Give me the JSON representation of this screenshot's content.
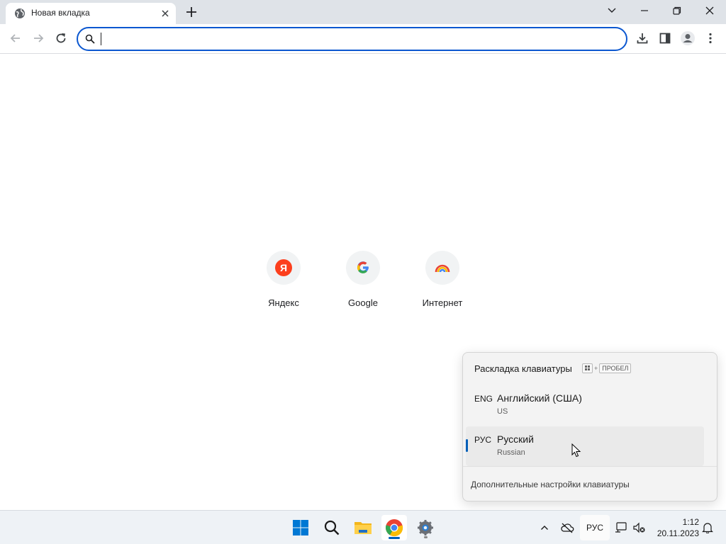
{
  "browser": {
    "tab": {
      "title": "Новая вкладка",
      "icon": "globe-icon"
    },
    "omnibox": {
      "value": "",
      "placeholder": ""
    },
    "shortcuts": [
      {
        "label": "Яндекс",
        "icon": "yandex-icon",
        "glyph": "Я",
        "color": "#fc3f1d"
      },
      {
        "label": "Google",
        "icon": "google-icon",
        "glyph": "G",
        "color": "#4285f4"
      },
      {
        "label": "Интернет",
        "icon": "internet-rainbow-icon"
      }
    ]
  },
  "flyout": {
    "title": "Раскладка клавиатуры",
    "shortcut_key": "ПРОБЕЛ",
    "shortcut_plus": "+",
    "languages": [
      {
        "code": "ENG",
        "name": "Английский (США)",
        "sub": "US",
        "selected": false
      },
      {
        "code": "РУС",
        "name": "Русский",
        "sub": "Russian",
        "selected": true
      }
    ],
    "more_settings": "Дополнительные настройки клавиатуры",
    "accent": "#005fb8"
  },
  "taskbar": {
    "apps": [
      "start-icon",
      "search-icon",
      "file-explorer-icon",
      "chrome-icon",
      "settings-icon"
    ],
    "lang": "РУС",
    "time": "1:12",
    "date": "20.11.2023"
  }
}
